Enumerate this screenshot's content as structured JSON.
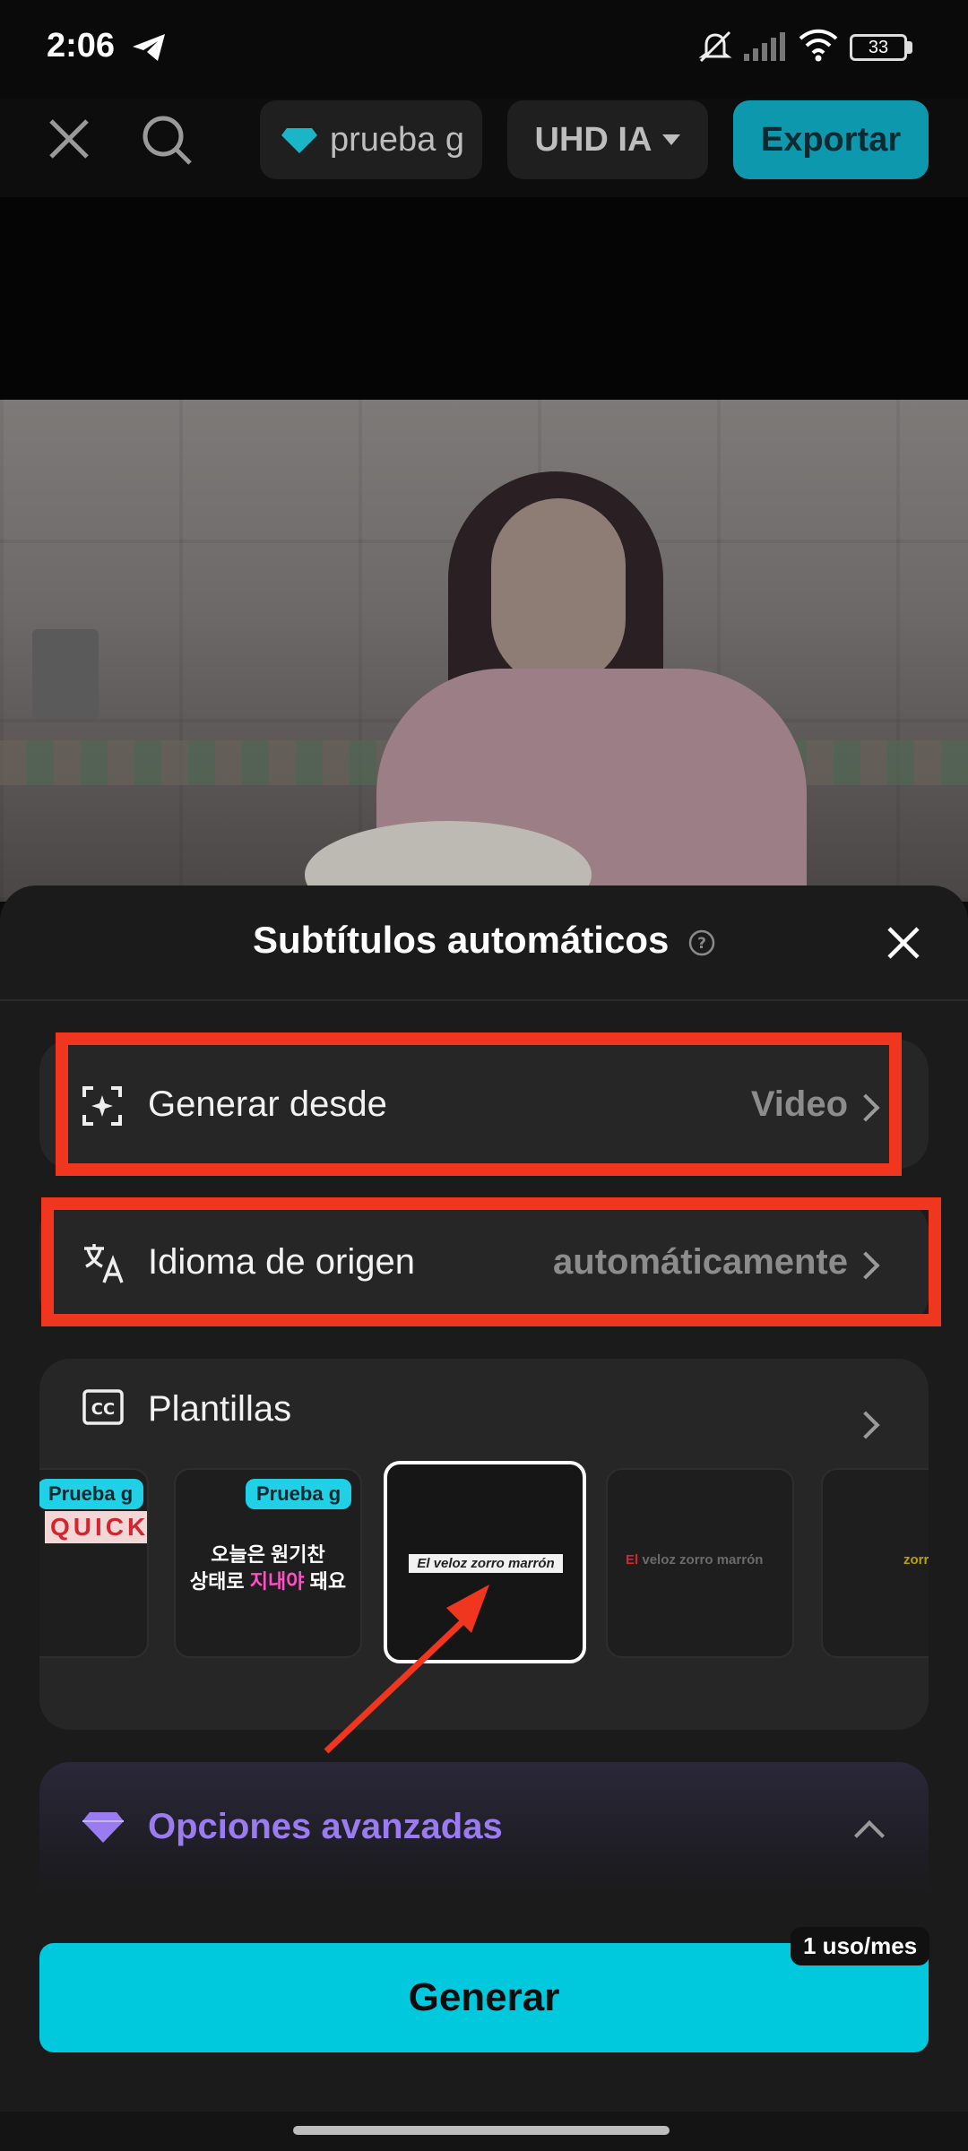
{
  "status_bar": {
    "time": "2:06",
    "battery": "33"
  },
  "top_bar": {
    "project_name": "prueba g",
    "quality_label": "UHD IA",
    "export_label": "Exportar"
  },
  "sheet": {
    "title": "Subtítulos automáticos",
    "generate_from": {
      "label": "Generar desde",
      "value": "Video"
    },
    "source_language": {
      "label": "Idioma de origen",
      "value": "automáticamente"
    },
    "templates": {
      "label": "Plantillas",
      "items": [
        {
          "badge": "Prueba g",
          "preview_text": "QUICK"
        },
        {
          "badge": "Prueba g",
          "preview_line1": "오늘은 원기찬",
          "preview_line2a": "상태로 ",
          "preview_line2b": "지내야",
          "preview_line2c": " 돼요"
        },
        {
          "preview_text": "El veloz zorro marrón"
        },
        {
          "preview_word1": "El",
          "preview_rest": "veloz zorro marrón"
        },
        {
          "preview_text": "zorro"
        }
      ]
    },
    "advanced_options_label": "Opciones avanzadas",
    "generate_label": "Generar",
    "usage_badge": "1 uso/mes"
  },
  "colors": {
    "accent": "#00c8dd",
    "export_bg": "#0e98ad",
    "annotation_red": "#f0361e",
    "premium_purple": "#9b7cf0"
  }
}
